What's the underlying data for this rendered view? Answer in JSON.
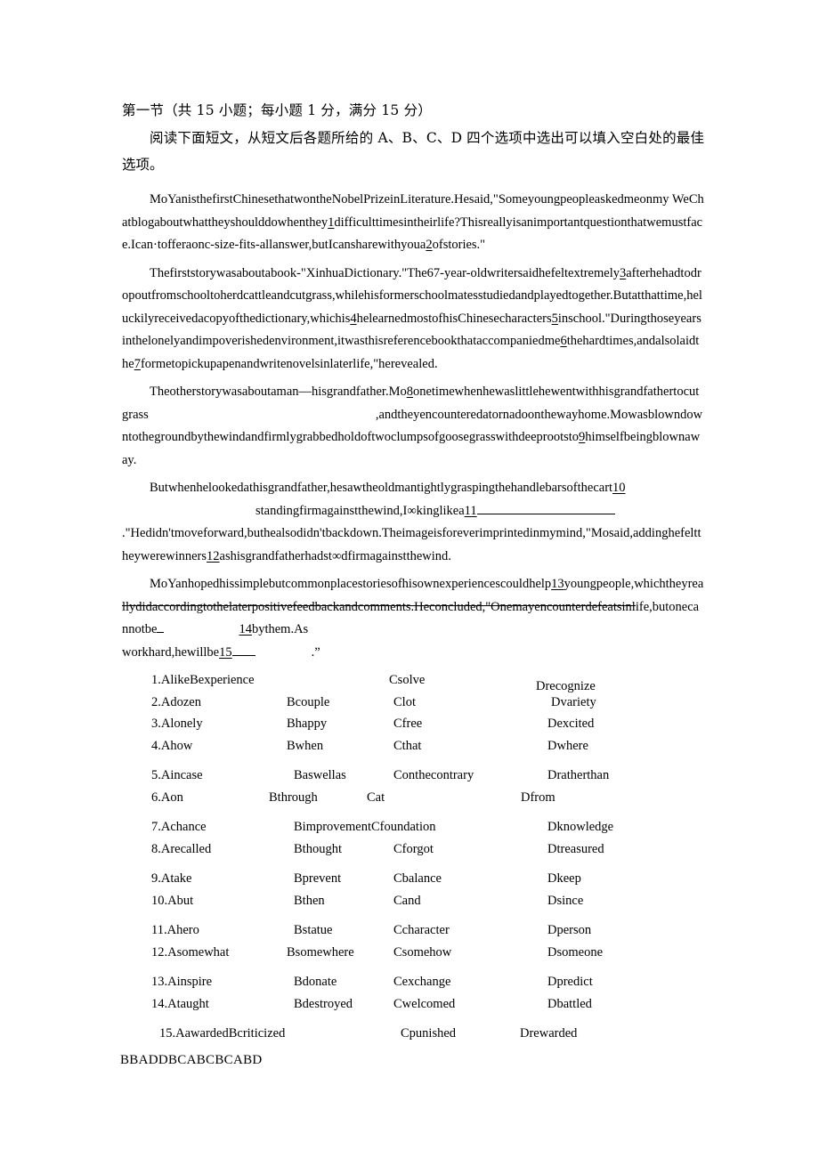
{
  "document": {
    "section_heading": "第一节（共 15 小题；每小题 1 分，满分 15 分）",
    "instruction": "阅读下面短文，从短文后各题所给的 A、B、C、D 四个选项中选出可以填入空白处的最佳选项。"
  },
  "passage": {
    "p1": {
      "text_a": "MoYanisthefirstChinesethatwontheNobelPrizeinLiterature.Hesaid,\"Someyoungpeopleaskedmeonmy WeChatblogaboutwhattheyshoulddowhenthey",
      "blank1": "1",
      "text_b": "difficulttimesintheirlife?Thisreallyisanimportantquestionthatwemustface.Ican·tofferaonc-size-fits-allanswer,butIcansharewithyoua",
      "blank2": "2",
      "text_c": "ofstories.\""
    },
    "p2": {
      "text_a": "Thefirststorywasaboutabook-\"XinhuaDictionary.\"The67-year-oldwritersaidhefeltextremely",
      "blank3": "3",
      "text_b": "afterhehadtodropoutfromschooltoherdcattleandcutgrass,whilehisformerschoolmatesstudiedandplayedtogether.Butatthattime,heluckilyreceivedacopyofthedictionary,whichis",
      "blank4": "4",
      "text_c": "helearnedmostofhisChinesecharacters",
      "blank5": "5",
      "text_d": "inschool.\"Duringthoseyearsinthelonelyandimpoverishedenvironment,itwasthisreferencebookthataccompaniedme",
      "blank6": "6",
      "text_e": "thehardtimes,andalsolaidthe",
      "blank7": "7",
      "text_f": "formetopickupapenandwritenovelsinlaterlife,\"herevealed."
    },
    "p3": {
      "text_a": "Theotherstorywasaboutaman—hisgrandfather.Mo",
      "blank8": "8",
      "text_b": "onetimewhenhewaslittlehewentwithhisgrandfathertocutgrass",
      "stray_comma": ",",
      "text_c": "andtheyencounteredatornadoonthewayhome.Mowasblowndowntothegroundbythewindandfirmlygrabbedholdoftwoclumpsofgoosegrasswithdeeprootsto",
      "blank9": "9",
      "text_d": "himselfbeingblownaway."
    },
    "p4": {
      "text_a": "Butwhenhelookedathisgrandfather,hesawtheoldmantightlygraspingthehandlebarsofthecart",
      "blank10": "10",
      "text_b": "standingfirmagainstthewind,I∞kinglikea",
      "blank11": "11",
      "text_c": ".\"Hedidn'tmoveforward,buthealsodidn'tbackdown.Theimageisforeverimprintedinmymind,\"Mosaid,addinghefelttheywerewinners",
      "blank12": "12",
      "text_d": "ashisgrandfatherhadst∞dfirmagainstthewind."
    },
    "p5": {
      "text_a": "MoYanhopedhissimplebutcommonplacestoriesofhisownexperiencescouldhelp",
      "blank13": "13",
      "text_b": "youngpeople,whichtheyreallydidaccordingtothelaterpositivefeedbackandcomments.Heconcluded,\"Onemayencounterdefeatsinlife,butonecannotbe",
      "blank14": "14",
      "text_c": "bythem.As",
      "text_d": "workhard,hewillbe",
      "blank15": "15",
      "text_e": ".”"
    }
  },
  "options": {
    "rows": [
      {
        "number": "1.",
        "a": "Alike",
        "b": "Bexperience",
        "c": "Csolve",
        "d": "Drecognize"
      },
      {
        "number": "2.",
        "a": "Adozen",
        "b": "Bcouple",
        "c": "Clot",
        "d": "Dvariety"
      },
      {
        "number": "3.",
        "a": "Alonely",
        "b": "Bhappy",
        "c": "Cfree",
        "d": "Dexcited"
      },
      {
        "number": "4.",
        "a": "Ahow",
        "b": "Bwhen",
        "c": "Cthat",
        "d": "Dwhere"
      },
      {
        "number": "5.",
        "a": "Aincase",
        "b": "Baswellas",
        "c": "Conthecontrary",
        "d": "Dratherthan"
      },
      {
        "number": "6.",
        "a": "Aon",
        "b": "Bthrough",
        "c": "Cat",
        "d": "Dfrom"
      },
      {
        "number": "7.",
        "a": "Achance",
        "b": "Bimprovement",
        "c": "Cfoundation",
        "d": "Dknowledge"
      },
      {
        "number": "8.",
        "a": "Arecalled",
        "b": "Bthought",
        "c": "Cforgot",
        "d": "Dtreasured"
      },
      {
        "number": "9.",
        "a": "Atake",
        "b": "Bprevent",
        "c": "Cbalance",
        "d": "Dkeep"
      },
      {
        "number": "10.",
        "a": "Abut",
        "b": "Bthen",
        "c": "Cand",
        "d": "Dsince"
      },
      {
        "number": "11.",
        "a": "Ahero",
        "b": "Bstatue",
        "c": "Ccharacter",
        "d": "Dperson"
      },
      {
        "number": "12.",
        "a": "Asomewhat",
        "b": "Bsomewhere",
        "c": "Csomehow",
        "d": "Dsomeone"
      },
      {
        "number": "13.",
        "a": "Ainspire",
        "b": "Bdonate",
        "c": "Cexchange",
        "d": "Dpredict"
      },
      {
        "number": "14.",
        "a": "Ataught",
        "b": "Bdestroyed",
        "c": "Cwelcomed",
        "d": "Dbattled"
      },
      {
        "number": "15.",
        "a": "Aawarded",
        "b": "Bcriticized",
        "c": "Cpunished",
        "d": "Drewarded"
      }
    ]
  },
  "answer_key": "BBADDBCABCBCABD"
}
